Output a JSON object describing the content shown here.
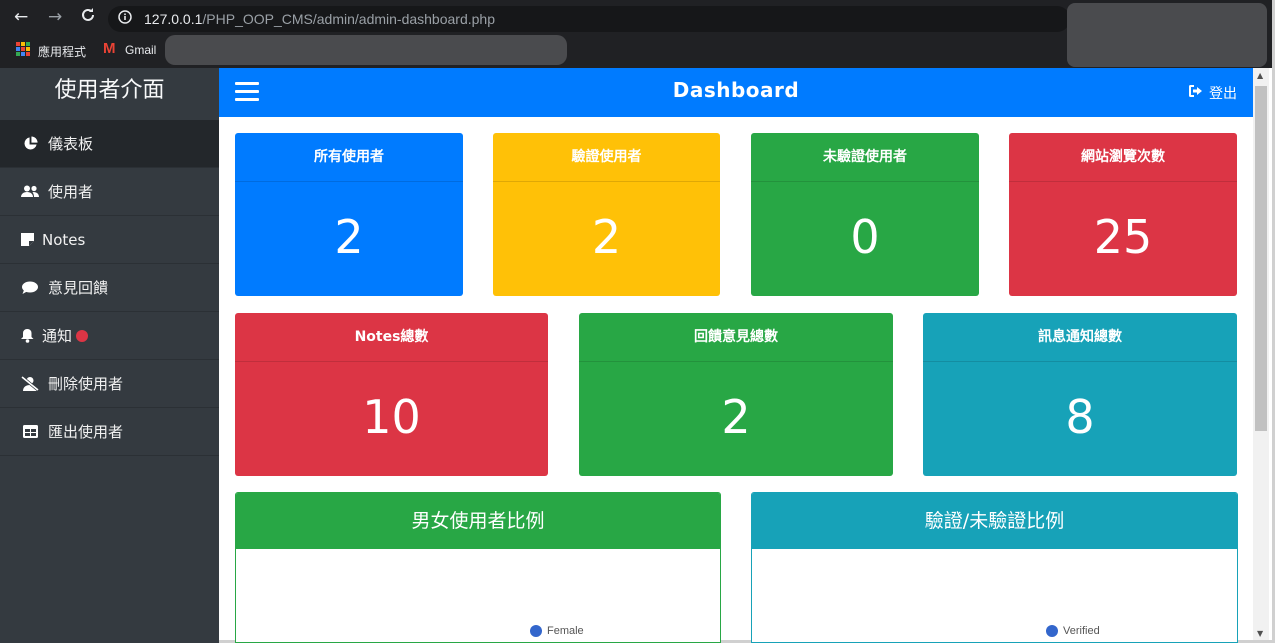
{
  "browser": {
    "url_host": "127.0.0.1",
    "url_path": "/PHP_OOP_CMS/admin/admin-dashboard.php",
    "bookmarks": [
      {
        "label": "應用程式"
      },
      {
        "label": "Gmail"
      }
    ]
  },
  "sidebar": {
    "title": "使用者介面",
    "items": [
      {
        "label": "儀表板",
        "icon": "pie-chart-icon",
        "active": true
      },
      {
        "label": "使用者",
        "icon": "users-icon"
      },
      {
        "label": "Notes",
        "icon": "note-icon"
      },
      {
        "label": "意見回饋",
        "icon": "comment-icon"
      },
      {
        "label": "通知",
        "icon": "bell-icon",
        "badge": true
      },
      {
        "label": "刪除使用者",
        "icon": "user-slash-icon"
      },
      {
        "label": "匯出使用者",
        "icon": "table-icon"
      }
    ]
  },
  "header": {
    "title": "Dashboard",
    "logout_label": "登出"
  },
  "stats_row1": [
    {
      "label": "所有使用者",
      "value": "2",
      "color": "#007bff"
    },
    {
      "label": "驗證使用者",
      "value": "2",
      "color": "#ffc107"
    },
    {
      "label": "未驗證使用者",
      "value": "0",
      "color": "#28a745"
    },
    {
      "label": "網站瀏覽次數",
      "value": "25",
      "color": "#dc3545"
    }
  ],
  "stats_row2": [
    {
      "label": "Notes總數",
      "value": "10",
      "color": "#dc3545"
    },
    {
      "label": "回饋意見總數",
      "value": "2",
      "color": "#28a745"
    },
    {
      "label": "訊息通知總數",
      "value": "8",
      "color": "#17a2b8"
    }
  ],
  "charts": [
    {
      "title": "男女使用者比例",
      "legend": "Female",
      "color": "#28a745"
    },
    {
      "title": "驗證/未驗證比例",
      "legend": "Verified",
      "color": "#17a2b8"
    }
  ]
}
